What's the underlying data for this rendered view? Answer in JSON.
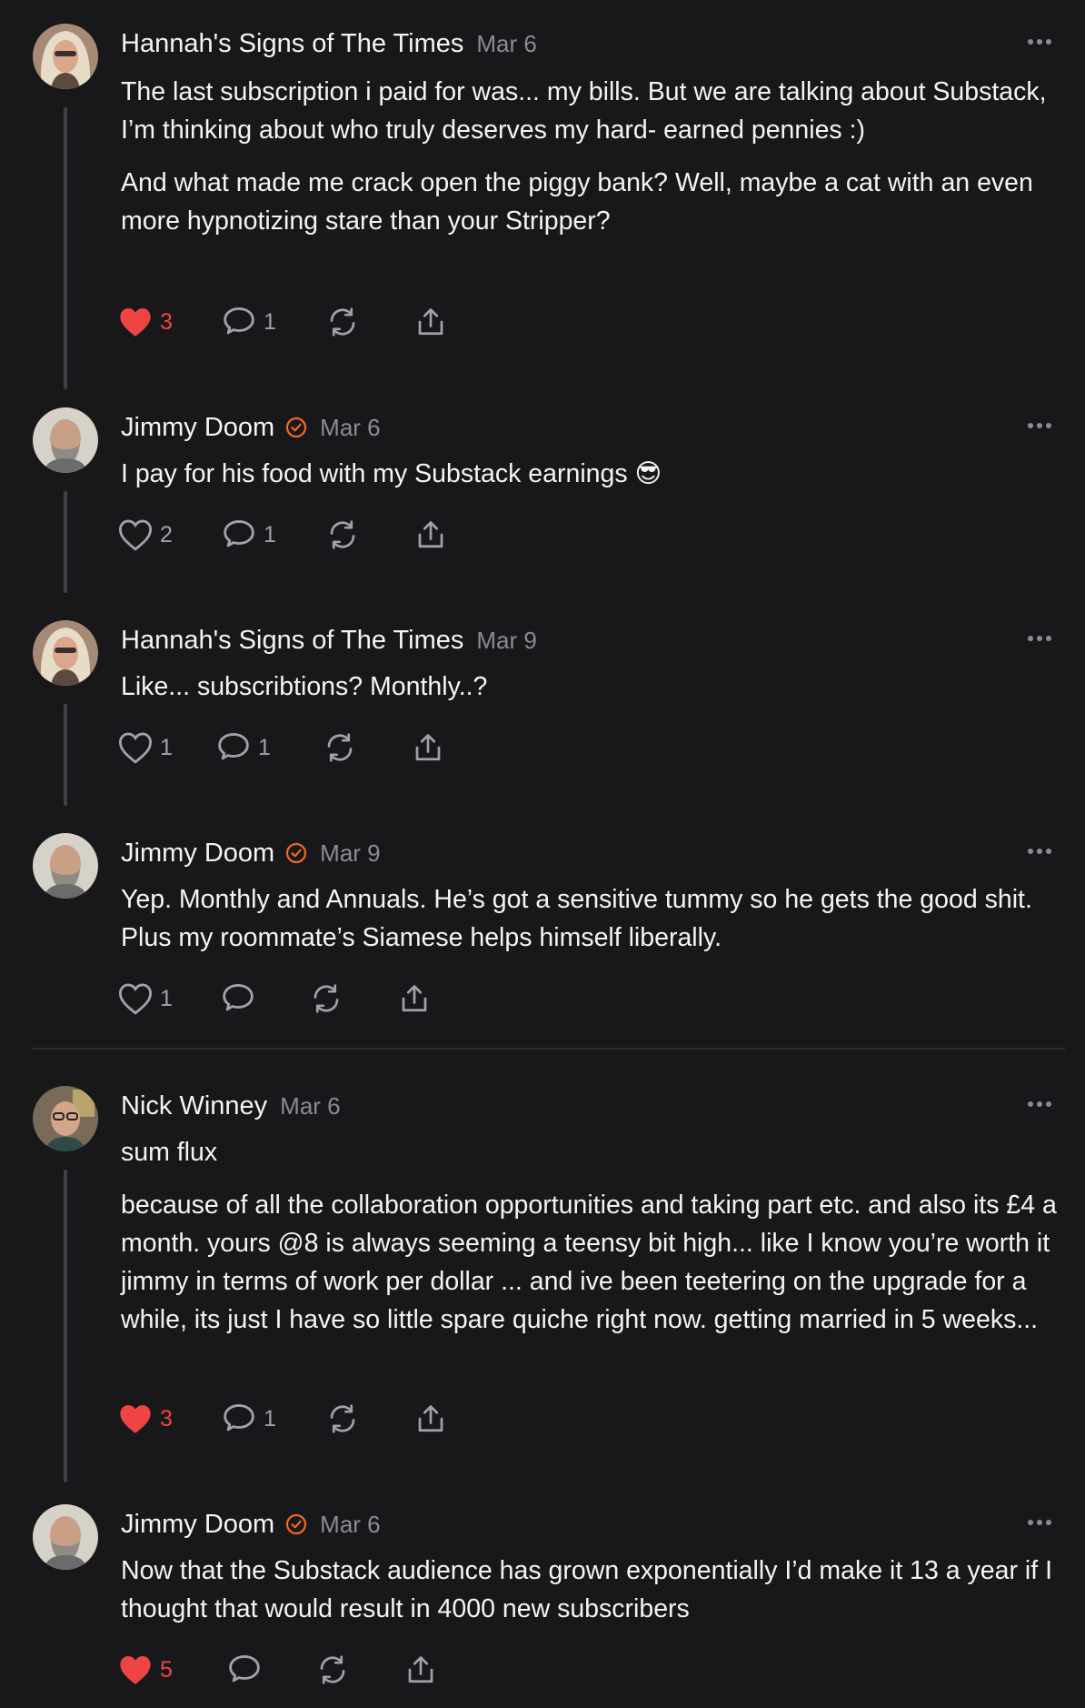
{
  "comments": [
    {
      "author": "Hannah's Signs of The Times",
      "date": "Mar 6",
      "paragraphs": [
        "The last subscription i paid for was... my bills. But we are talking about Substack, I’m thinking about who truly deserves my hard- earned pennies :)",
        "And what made me crack open the piggy bank? Well, maybe a cat with an even more hypnotizing stare than your Stripper?"
      ],
      "likes": "3",
      "replies": "1",
      "liked": true
    },
    {
      "author": "Jimmy Doom",
      "date": "Mar 6",
      "verified": true,
      "paragraphs": [
        "I pay for his food with my Substack earnings 😎"
      ],
      "likes": "2",
      "replies": "1",
      "liked": false
    },
    {
      "author": "Hannah's Signs of The Times",
      "date": "Mar 9",
      "paragraphs": [
        "Like... subscribtions? Monthly..?"
      ],
      "likes": "1",
      "replies": "1",
      "liked": false
    },
    {
      "author": "Jimmy Doom",
      "date": "Mar 9",
      "verified": true,
      "paragraphs": [
        "Yep. Monthly and Annuals. He’s got a sensitive tummy so he gets the good shit. Plus my roommate’s Siamese helps himself liberally."
      ],
      "likes": "1",
      "replies": "",
      "liked": false
    },
    {
      "author": "Nick Winney",
      "date": "Mar 6",
      "paragraphs": [
        "sum flux",
        "because of all the collaboration opportunities and taking part etc. and also its £4 a month. yours @8 is always seeming a teensy bit high... like I know you’re worth it jimmy in terms of work per dollar ... and ive been teetering on the upgrade for a while, its just I have so little spare quiche right now. getting married in 5 weeks..."
      ],
      "likes": "3",
      "replies": "1",
      "liked": true
    },
    {
      "author": "Jimmy Doom",
      "date": "Mar 6",
      "verified": true,
      "paragraphs": [
        "Now that the Substack audience has grown exponentially I’d make it 13 a year if I thought that would result in 4000 new subscribers"
      ],
      "likes": "5",
      "replies": "",
      "liked": true
    }
  ],
  "icons": {
    "like": "heart-icon",
    "reply": "comment-icon",
    "restack": "restack-icon",
    "share": "share-icon",
    "more": "more-icon",
    "verified": "verified-check-icon"
  },
  "colors": {
    "background": "#18181b",
    "liked": "#ef4444",
    "verified": "#f26b1d",
    "muted": "#a1a1aa"
  }
}
